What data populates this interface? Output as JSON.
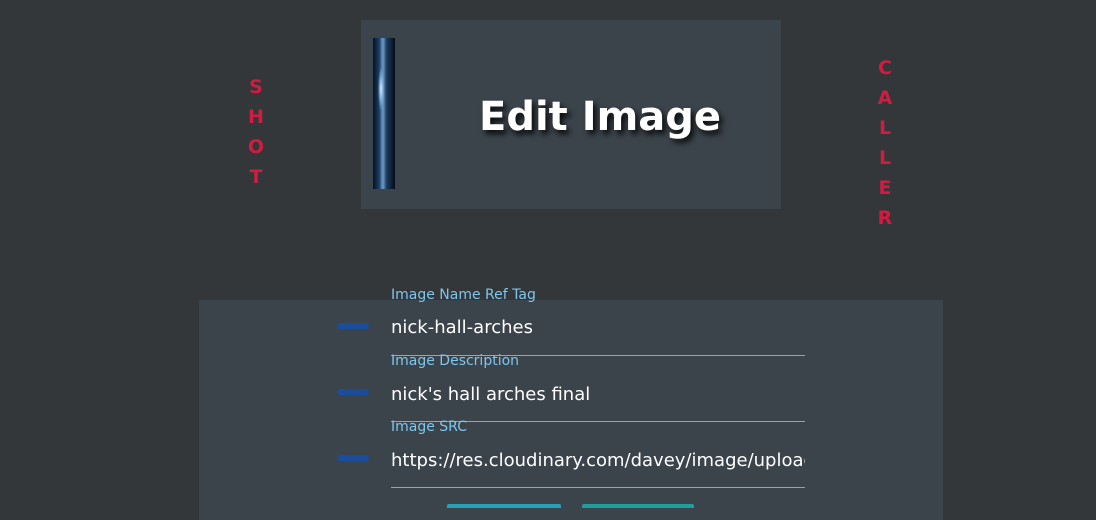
{
  "side_left": {
    "letters": [
      "S",
      "H",
      "O",
      "T"
    ]
  },
  "side_right": {
    "letters": [
      "C",
      "A",
      "L",
      "L",
      "E",
      "R"
    ]
  },
  "header": {
    "title": "Edit Image"
  },
  "form": {
    "fields": [
      {
        "label": "Image Name Ref Tag",
        "value": "nick-hall-arches"
      },
      {
        "label": "Image Description",
        "value": "nick's hall arches final"
      },
      {
        "label": "Image SRC",
        "value": "https://res.cloudinary.com/davey/image/upload"
      }
    ]
  },
  "colors": {
    "background": "#333739",
    "card": "#3b434b",
    "accent_red": "#d21b40",
    "label_blue": "#7ec6ec",
    "dash_blue": "#1a4d9c"
  }
}
